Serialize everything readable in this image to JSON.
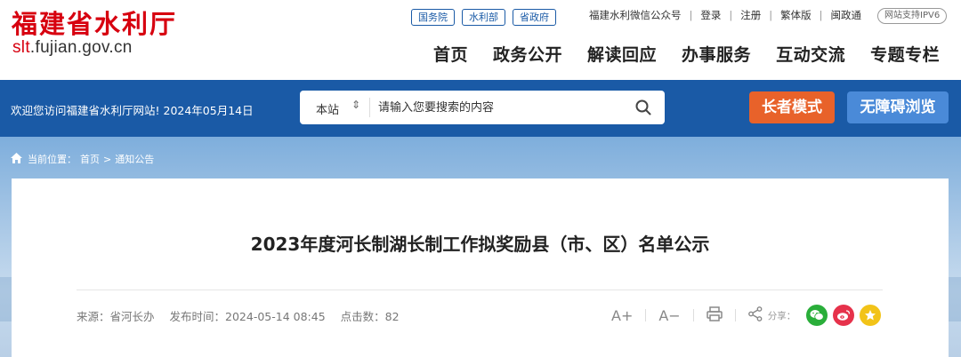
{
  "header": {
    "logo_cn": "福建省水利厅",
    "logo_en_pre": "slt",
    "logo_en_post": ".fujian.gov.cn",
    "gov_links": [
      "国务院",
      "水利部",
      "省政府"
    ],
    "top_links": [
      "福建水利微信公众号",
      "登录",
      "注册",
      "繁体版",
      "闽政通"
    ],
    "ipv6": "网站支持IPV6",
    "nav": [
      "首页",
      "政务公开",
      "解读回应",
      "办事服务",
      "互动交流",
      "专题专栏"
    ]
  },
  "bar": {
    "welcome": "欢迎您访问福建省水利厅网站! 2024年05月14日",
    "search_scope": "本站",
    "search_placeholder": "请输入您要搜索的内容",
    "elder_mode": "长者模式",
    "accessible": "无障碍浏览"
  },
  "breadcrumb": {
    "label": "当前位置：",
    "home": "首页",
    "sep": ">",
    "current": "通知公告"
  },
  "article": {
    "title": "2023年度河长制湖长制工作拟奖励县（市、区）名单公示",
    "source": "来源：省河长办",
    "published": "发布时间：2024-05-14 08:45",
    "views": "点击数：82",
    "font_up": "A+",
    "font_down": "A−",
    "share_label": "分享："
  },
  "colors": {
    "brand_red": "#d7000f",
    "primary_blue": "#1a5aa6",
    "elder_orange": "#e8622a",
    "accessible_blue": "#4a8ad8",
    "wechat_green": "#2aae3a",
    "weibo_red": "#e6324b",
    "favorite_yellow": "#f2c318"
  }
}
